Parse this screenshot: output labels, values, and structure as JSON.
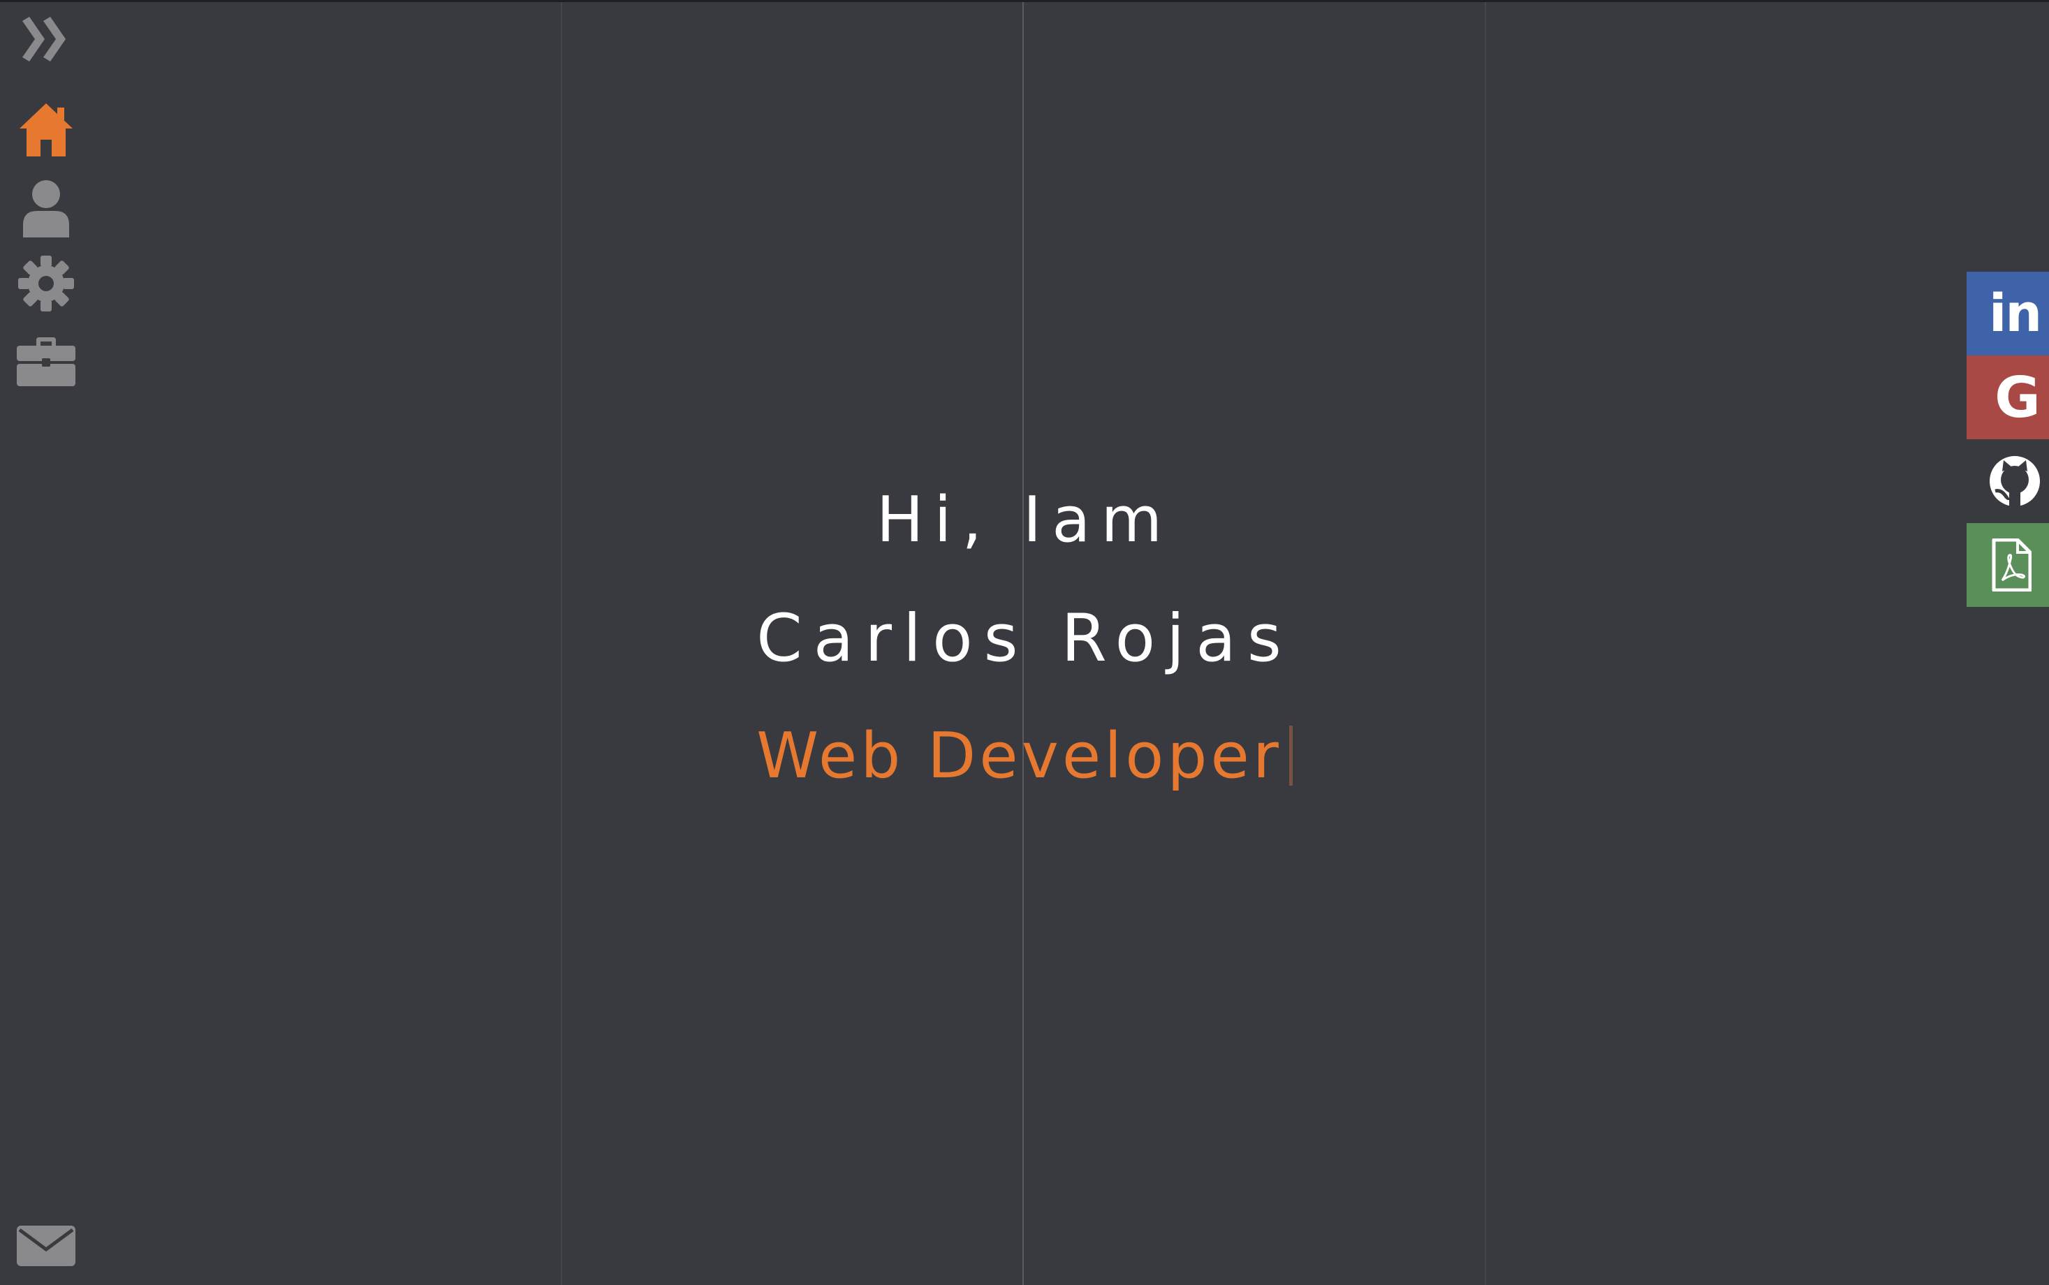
{
  "hero": {
    "greeting": "Hi, Iam",
    "name": "Carlos Rojas",
    "role": "Web Developer"
  },
  "sidebar": {
    "items": [
      {
        "icon": "double-chevron-right-icon",
        "active": false
      },
      {
        "icon": "home-icon",
        "active": true
      },
      {
        "icon": "user-icon",
        "active": false
      },
      {
        "icon": "gear-icon",
        "active": false
      },
      {
        "icon": "briefcase-icon",
        "active": false
      },
      {
        "icon": "mail-icon",
        "active": false
      }
    ]
  },
  "social": {
    "items": [
      {
        "icon": "linkedin-icon",
        "label": "in",
        "color": "#3e63a8"
      },
      {
        "icon": "google-icon",
        "label": "G",
        "color": "#a94945"
      },
      {
        "icon": "github-icon",
        "label": "",
        "color": "#393a3f"
      },
      {
        "icon": "pdf-icon",
        "label": "",
        "color": "#5a8f5a"
      }
    ]
  },
  "colors": {
    "background": "#393a3f",
    "accent": "#e6782f",
    "icon_inactive": "#8a8a8c",
    "text": "#ffffff"
  }
}
